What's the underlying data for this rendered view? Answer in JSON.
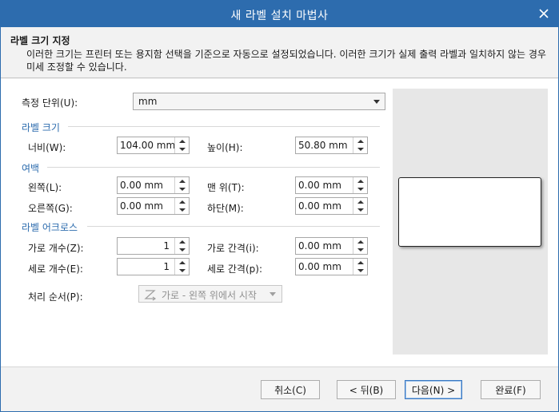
{
  "window": {
    "title": "새 라벨 설치 마법사"
  },
  "header": {
    "title": "라벨 크기 지정",
    "description": "이러한 크기는 프린터 또는 용지함 선택을 기준으로 자동으로 설정되었습니다. 이러한 크기가 실제 출력 라벨과 일치하지 않는 경우 미세 조정할 수 있습니다."
  },
  "units": {
    "label": "측정 단위(U):",
    "value": "mm"
  },
  "label_size": {
    "section": "라벨 크기",
    "width_label": "너비(W):",
    "width_value": "104.00 mm",
    "height_label": "높이(H):",
    "height_value": "50.80 mm"
  },
  "margins": {
    "section": "여백",
    "left_label": "왼쪽(L):",
    "left_value": "0.00 mm",
    "top_label": "맨 위(T):",
    "top_value": "0.00 mm",
    "right_label": "오른쪽(G):",
    "right_value": "0.00 mm",
    "bottom_label": "하단(M):",
    "bottom_value": "0.00 mm"
  },
  "across": {
    "section": "라벨 어크로스",
    "hcount_label": "가로 개수(Z):",
    "hcount_value": "1",
    "hgap_label": "가로 간격(i):",
    "hgap_value": "0.00 mm",
    "vcount_label": "세로 개수(E):",
    "vcount_value": "1",
    "vgap_label": "세로 간격(p):",
    "vgap_value": "0.00 mm"
  },
  "order": {
    "label": "처리 순서(P):",
    "value": "가로 - 왼쪽 위에서 시작",
    "icon": "z-order-icon"
  },
  "buttons": {
    "cancel": "취소(C)",
    "back": "< 뒤(B)",
    "next": "다음(N) >",
    "finish": "완료(F)"
  },
  "colors": {
    "titlebar": "#2d6cae",
    "section": "#2d6cae",
    "preview_bg": "#e7e7e7"
  }
}
